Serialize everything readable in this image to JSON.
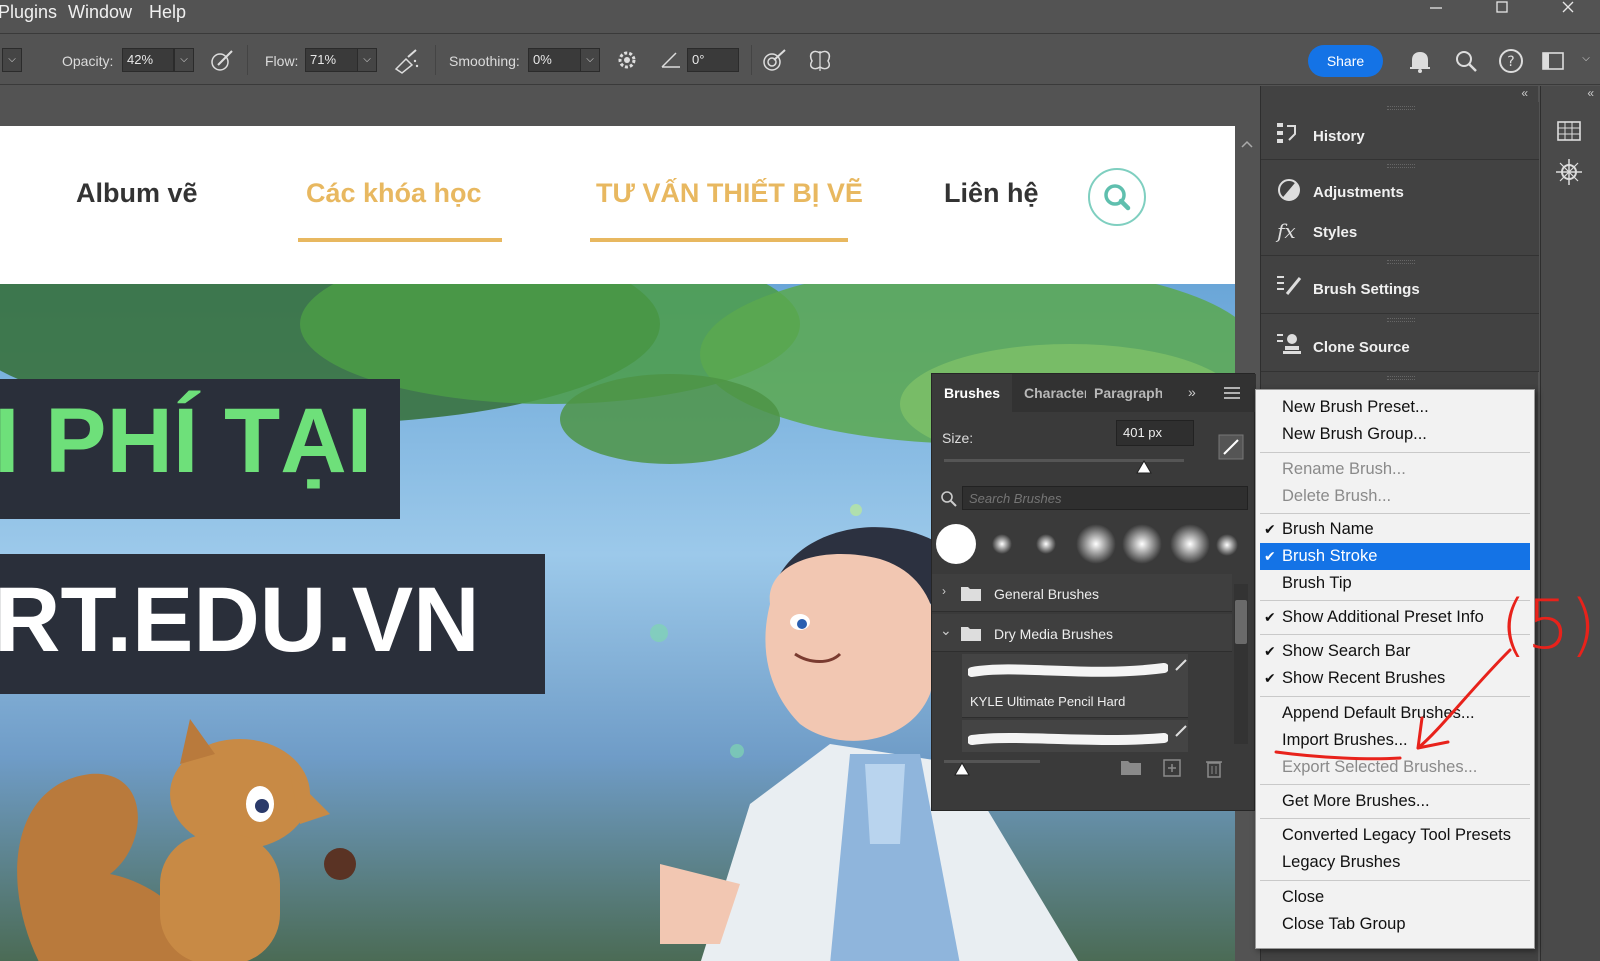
{
  "menubar": {
    "items": [
      "Plugins",
      "Window",
      "Help"
    ],
    "controls": [
      "minimize",
      "maximize",
      "close"
    ]
  },
  "options": {
    "opacity_label": "Opacity:",
    "opacity_value": "42%",
    "flow_label": "Flow:",
    "flow_value": "71%",
    "smoothing_label": "Smoothing:",
    "smoothing_value": "0%",
    "angle_value": "0°",
    "share_label": "Share",
    "icons": [
      "pressure-opacity-icon",
      "airbrush-icon",
      "gear-icon",
      "angle-icon",
      "pressure-size-icon",
      "symmetry-icon",
      "bell-icon",
      "search-icon",
      "help-icon",
      "workspace-icon"
    ]
  },
  "website": {
    "nav": [
      {
        "label": "Album vẽ",
        "color": "#333333"
      },
      {
        "label": "Các khóa học",
        "color": "#e8b860"
      },
      {
        "label": "TƯ VẤN THIẾT BỊ VẼ",
        "color": "#e8b860"
      },
      {
        "label": "Liên hệ",
        "color": "#333333"
      }
    ],
    "banner1": "I PHÍ TẠI",
    "banner2": "RT.EDU.VN",
    "accent_green": "#6ee07a",
    "accent_gold": "#e8b860",
    "accent_teal": "#7fcfc0"
  },
  "dock": {
    "items": [
      {
        "label": "History",
        "icon": "history-icon"
      },
      {
        "label": "Adjustments",
        "icon": "adjustments-icon"
      },
      {
        "label": "Styles",
        "icon": "styles-icon"
      },
      {
        "label": "Brush Settings",
        "icon": "brush-settings-icon"
      },
      {
        "label": "Clone Source",
        "icon": "clone-source-icon"
      }
    ],
    "strip_icons": [
      "grid-icon",
      "navigator-icon"
    ]
  },
  "brushes_panel": {
    "tabs": [
      "Brushes",
      "Character",
      "Paragraph"
    ],
    "size_label": "Size:",
    "size_value": "401 px",
    "search_placeholder": "Search Brushes",
    "groups": [
      {
        "label": "General Brushes",
        "expanded": false
      },
      {
        "label": "Dry Media Brushes",
        "expanded": true
      }
    ],
    "brush_items": [
      "KYLE Ultimate Pencil Hard"
    ]
  },
  "context_menu": {
    "items": [
      {
        "label": "New Brush Preset...",
        "checked": false,
        "disabled": false
      },
      {
        "label": "New Brush Group...",
        "checked": false,
        "disabled": false
      },
      {
        "label": "Rename Brush...",
        "checked": false,
        "disabled": true
      },
      {
        "label": "Delete Brush...",
        "checked": false,
        "disabled": true
      },
      {
        "label": "Brush Name",
        "checked": true,
        "disabled": false
      },
      {
        "label": "Brush Stroke",
        "checked": true,
        "disabled": false,
        "highlighted": true
      },
      {
        "label": "Brush Tip",
        "checked": false,
        "disabled": false
      },
      {
        "label": "Show Additional Preset Info",
        "checked": true,
        "disabled": false
      },
      {
        "label": "Show Search Bar",
        "checked": true,
        "disabled": false
      },
      {
        "label": "Show Recent Brushes",
        "checked": true,
        "disabled": false
      },
      {
        "label": "Append Default Brushes...",
        "checked": false,
        "disabled": false
      },
      {
        "label": "Import Brushes...",
        "checked": false,
        "disabled": false
      },
      {
        "label": "Export Selected Brushes...",
        "checked": false,
        "disabled": true
      },
      {
        "label": "Get More Brushes...",
        "checked": false,
        "disabled": false
      },
      {
        "label": "Converted Legacy Tool Presets",
        "checked": false,
        "disabled": false
      },
      {
        "label": "Legacy Brushes",
        "checked": false,
        "disabled": false
      },
      {
        "label": "Close",
        "checked": false,
        "disabled": false
      },
      {
        "label": "Close Tab Group",
        "checked": false,
        "disabled": false
      }
    ],
    "highlight_color": "#1473e6"
  },
  "annotation": {
    "step_label": "(5)",
    "color": "#e8221b"
  }
}
